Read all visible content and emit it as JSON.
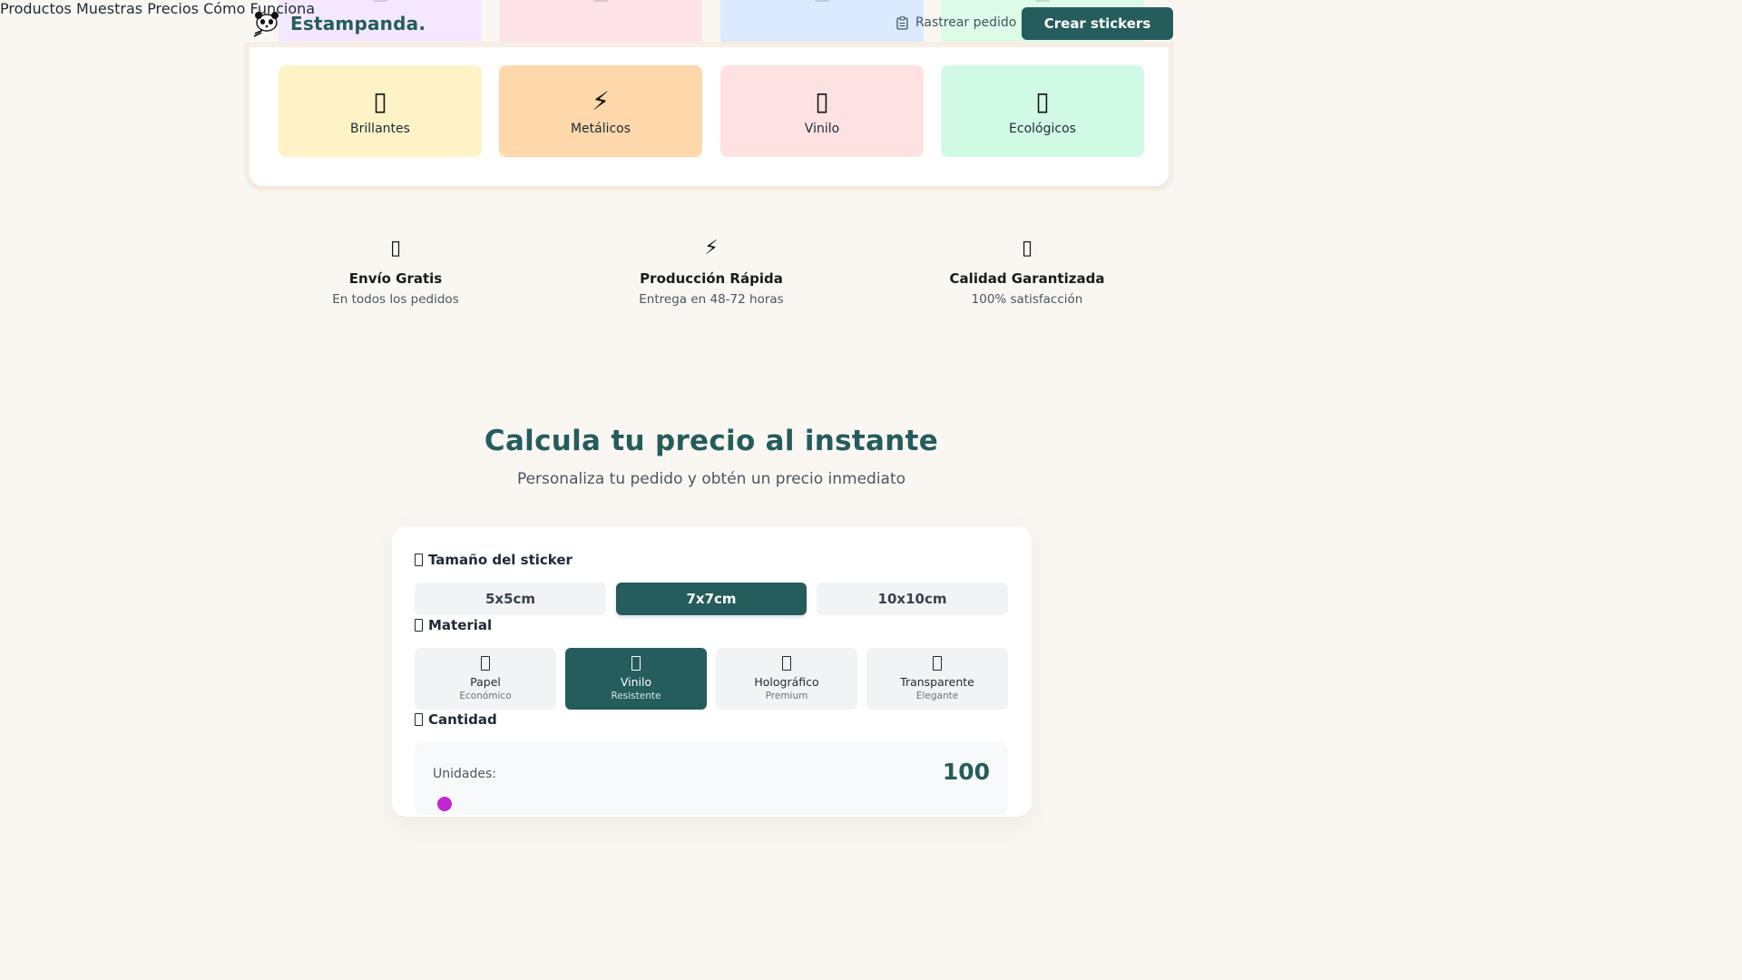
{
  "brand": {
    "name": "Estampanda."
  },
  "nav": {
    "items": [
      "Productos",
      "Muestras",
      "Precios",
      "Cómo Funciona"
    ],
    "track_label": "Rastrear pedido",
    "cta_label": "Crear stickers"
  },
  "categories": [
    {
      "label": "Brillantes",
      "icon": "sparkles-icon",
      "glyph": "▯",
      "color": "#fef3c7"
    },
    {
      "label": "Metálicos",
      "icon": "lightning-icon",
      "glyph": "⚡",
      "color": "#fed7aa"
    },
    {
      "label": "Vinilo",
      "icon": "vinyl-icon",
      "glyph": "▯",
      "color": "#fee2e2"
    },
    {
      "label": "Ecológicos",
      "icon": "leaf-icon",
      "glyph": "▯",
      "color": "#d1fae5"
    }
  ],
  "peek_colors": [
    "#f3e8ff",
    "#fde2e8",
    "#dbeafe",
    "#dcfce7"
  ],
  "features": [
    {
      "title": "Envío Gratis",
      "subtitle": "En todos los pedidos",
      "icon": "truck-icon",
      "glyph": "▯"
    },
    {
      "title": "Producción Rápida",
      "subtitle": "Entrega en 48-72 horas",
      "icon": "lightning-icon",
      "glyph": "⚡"
    },
    {
      "title": "Calidad Garantizada",
      "subtitle": "100% satisfacción",
      "icon": "badge-icon",
      "glyph": "▯"
    }
  ],
  "calculator": {
    "title": "Calcula tu precio al instante",
    "subtitle": "Personaliza tu pedido y obtén un precio inmediato",
    "size_label": "Tamaño del sticker",
    "sizes": [
      "5x5cm",
      "7x7cm",
      "10x10cm"
    ],
    "selected_size": "7x7cm",
    "material_label": "Material",
    "materials": [
      {
        "name": "Papel",
        "desc": "Económico"
      },
      {
        "name": "Vinilo",
        "desc": "Resistente"
      },
      {
        "name": "Holográfico",
        "desc": "Premium"
      },
      {
        "name": "Transparente",
        "desc": "Elegante"
      }
    ],
    "selected_material": "Vinilo",
    "quantity_label": "Cantidad",
    "units_label": "Unidades:",
    "units_value": "100"
  },
  "colors": {
    "brand": "#255c5c",
    "background": "#faf7f2",
    "slider": "#c026d3"
  }
}
